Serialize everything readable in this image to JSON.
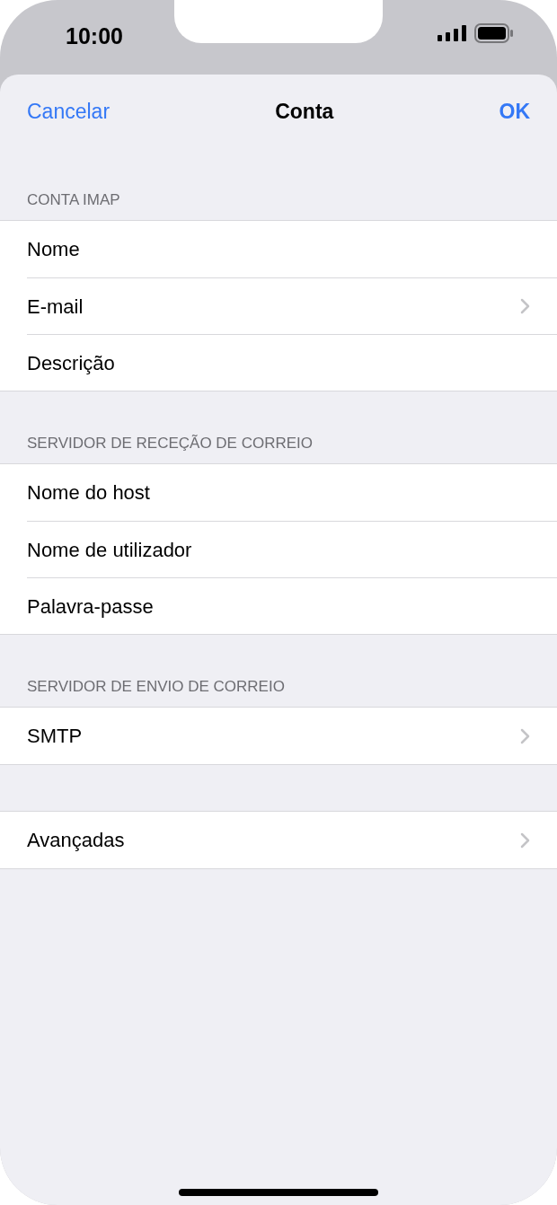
{
  "status_bar": {
    "time": "10:00"
  },
  "nav": {
    "cancel": "Cancelar",
    "title": "Conta",
    "ok": "OK"
  },
  "sections": [
    {
      "header": "CONTA IMAP",
      "rows": [
        {
          "label": "Nome",
          "chevron": false
        },
        {
          "label": "E-mail",
          "chevron": true
        },
        {
          "label": "Descrição",
          "chevron": false
        }
      ]
    },
    {
      "header": "SERVIDOR DE RECEÇÃO DE CORREIO",
      "rows": [
        {
          "label": "Nome do host",
          "chevron": false
        },
        {
          "label": "Nome de utilizador",
          "chevron": false
        },
        {
          "label": "Palavra-passe",
          "chevron": false
        }
      ]
    },
    {
      "header": "SERVIDOR DE ENVIO DE CORREIO",
      "rows": [
        {
          "label": "SMTP",
          "chevron": true
        }
      ]
    },
    {
      "rows": [
        {
          "label": "Avançadas",
          "chevron": true
        }
      ]
    }
  ]
}
